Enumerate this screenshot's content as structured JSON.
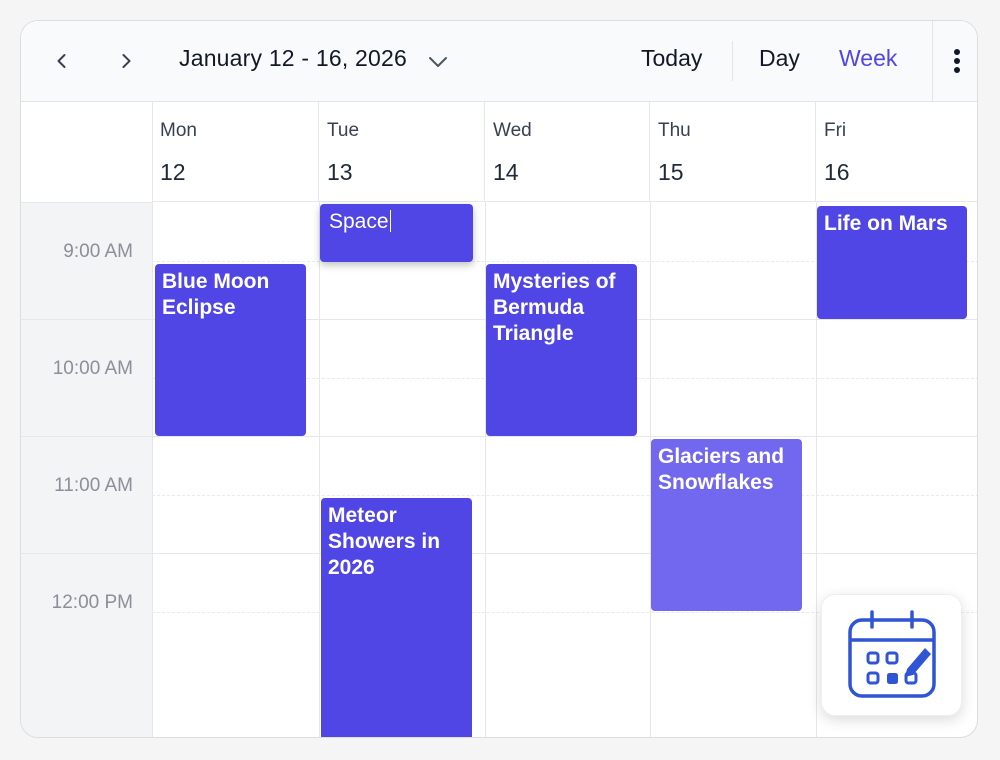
{
  "toolbar": {
    "prev_icon": "chevron-left-icon",
    "next_icon": "chevron-right-icon",
    "date_range": "January 12 - 16, 2026",
    "range_dropdown_icon": "chevron-down-icon",
    "today_label": "Today",
    "day_label": "Day",
    "week_label": "Week",
    "active_view": "Week",
    "more_icon": "more-vertical-icon"
  },
  "days": [
    {
      "name": "Mon",
      "number": "12"
    },
    {
      "name": "Tue",
      "number": "13"
    },
    {
      "name": "Wed",
      "number": "14"
    },
    {
      "name": "Thu",
      "number": "15"
    },
    {
      "name": "Fri",
      "number": "16"
    }
  ],
  "time_slots": [
    "9:00 AM",
    "10:00 AM",
    "11:00 AM",
    "12:00 PM"
  ],
  "events": [
    {
      "title": "Space",
      "day": "Tue",
      "editing": true
    },
    {
      "title": "Blue Moon Eclipse",
      "day": "Mon"
    },
    {
      "title": "Mysteries of Bermuda Triangle",
      "day": "Wed"
    },
    {
      "title": "Life on Mars",
      "day": "Fri"
    },
    {
      "title": "Glaciers and Snowflakes",
      "day": "Thu"
    },
    {
      "title": "Meteor Showers in 2026",
      "day": "Tue"
    }
  ],
  "fab": {
    "icon": "calendar-edit-icon"
  },
  "colors": {
    "accent": "#4f46e5",
    "event": "#4f46e5",
    "event_light": "#7268ef",
    "fab_icon": "#2f55d4"
  }
}
